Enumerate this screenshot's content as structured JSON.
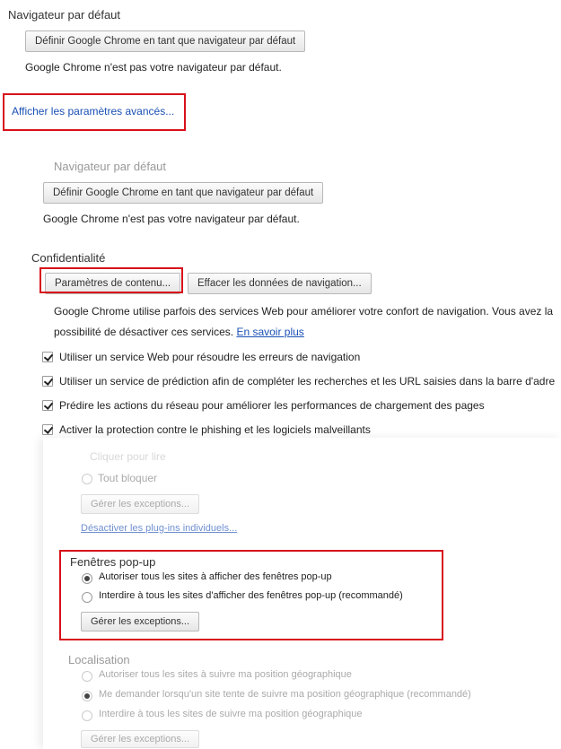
{
  "top": {
    "heading": "Navigateur par défaut",
    "set_default_button": "Définir Google Chrome en tant que navigateur par défaut",
    "status": "Google Chrome n'est pas votre navigateur par défaut.",
    "advanced_link": "Afficher les paramètres avancés..."
  },
  "middle": {
    "heading": "Navigateur par défaut",
    "set_default_button": "Définir Google Chrome en tant que navigateur par défaut",
    "status": "Google Chrome n'est pas votre navigateur par défaut."
  },
  "privacy": {
    "heading": "Confidentialité",
    "content_settings_button": "Paramètres de contenu...",
    "clear_data_button": "Effacer les données de navigation...",
    "description_line1": "Google Chrome utilise parfois des services Web pour améliorer votre confort de navigation. Vous avez la",
    "description_line2": "possibilité de désactiver ces services.",
    "learn_more": "En savoir plus",
    "options": [
      "Utiliser un service Web pour résoudre les erreurs de navigation",
      "Utiliser un service de prédiction afin de compléter les recherches et les URL saisies dans la barre d'adre",
      "Prédire les actions du réseau pour améliorer les performances de chargement des pages",
      "Activer la protection contre le phishing et les logiciels malveillants"
    ]
  },
  "plugins": {
    "faded_top_text": "Cliquer pour lire",
    "block_all": "Tout bloquer",
    "manage_exceptions": "Gérer les exceptions...",
    "disable_individual": "Désactiver les plug-ins individuels..."
  },
  "popups": {
    "heading": "Fenêtres pop-up",
    "allow": "Autoriser tous les sites à afficher des fenêtres pop-up",
    "block": "Interdire à tous les sites d'afficher des fenêtres pop-up (recommandé)",
    "manage_exceptions": "Gérer les exceptions..."
  },
  "location": {
    "heading": "Localisation",
    "allow": "Autoriser tous les sites à suivre ma position géographique",
    "ask": "Me demander lorsqu'un site tente de suivre ma position géographique (recommandé)",
    "block": "Interdire à tous les sites de suivre ma position géographique",
    "manage_exceptions": "Gérer les exceptions..."
  },
  "colors": {
    "highlight": "#d8111b",
    "link": "#1a50b5"
  }
}
